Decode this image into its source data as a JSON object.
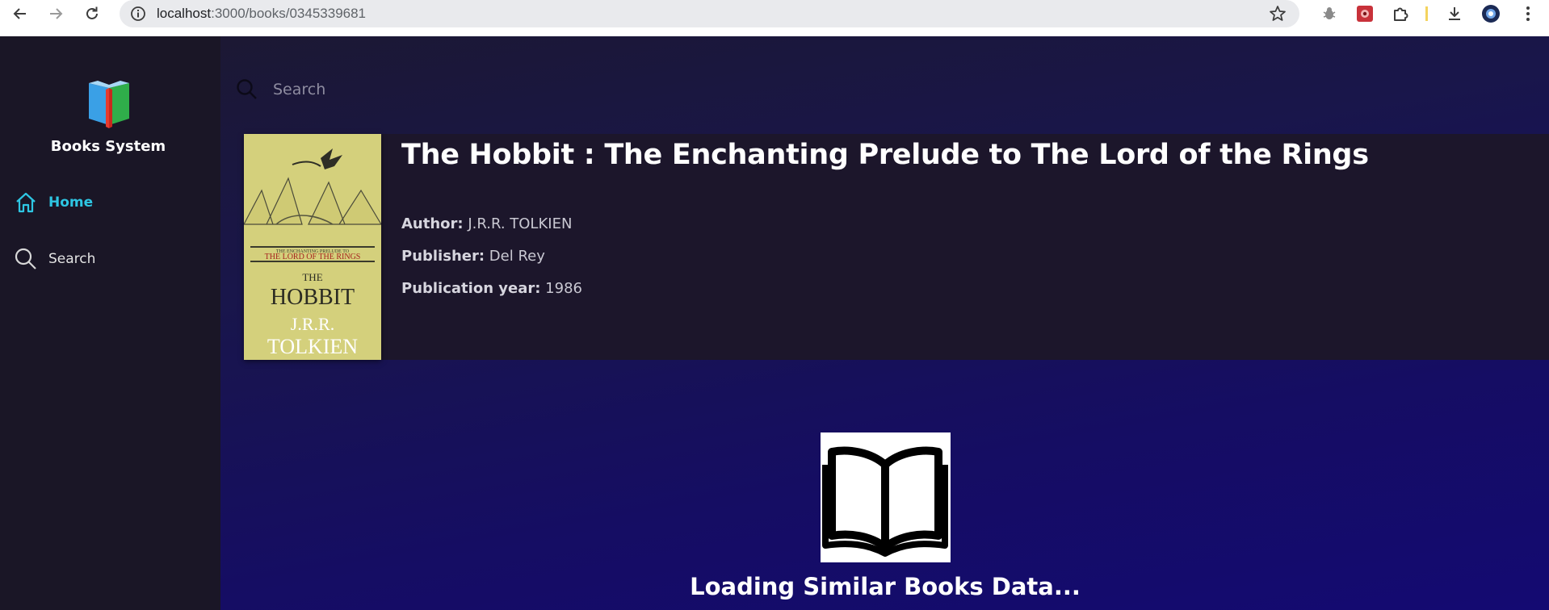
{
  "browser": {
    "url_host": "localhost",
    "url_path": ":3000/books/0345339681",
    "back_icon": "arrow-left-icon",
    "forward_icon": "arrow-right-icon",
    "reload_icon": "reload-icon",
    "site_info_icon": "info-icon",
    "bookmark_icon": "star-icon",
    "extensions": [
      "bug-extension-icon",
      "red-extension-icon",
      "puzzle-icon",
      "download-icon",
      "profile-avatar"
    ]
  },
  "sidebar": {
    "brand": "Books System",
    "items": [
      {
        "label": "Home",
        "icon": "home-icon",
        "active": true
      },
      {
        "label": "Search",
        "icon": "search-icon",
        "active": false
      }
    ]
  },
  "search": {
    "placeholder": "Search"
  },
  "book": {
    "title": "The Hobbit : The Enchanting Prelude to The Lord of the Rings",
    "author_label": "Author:",
    "author": "J.R.R. TOLKIEN",
    "publisher_label": "Publisher:",
    "publisher": "Del Rey",
    "year_label": "Publication year:",
    "year": "1986",
    "cover": {
      "top_line": "THE ENCHANTING PRELUDE TO",
      "banner": "THE LORD OF THE RINGS",
      "title_small": "THE",
      "title_big": "HOBBIT",
      "author_line1": "J.R.R.",
      "author_line2": "TOLKIEN"
    }
  },
  "loading": {
    "text": "Loading Similar Books Data...",
    "icon": "open-book-icon"
  },
  "colors": {
    "accent": "#2ec6e3",
    "sidebar_bg": "#1a1626",
    "panel_bg": "#1c162b"
  }
}
